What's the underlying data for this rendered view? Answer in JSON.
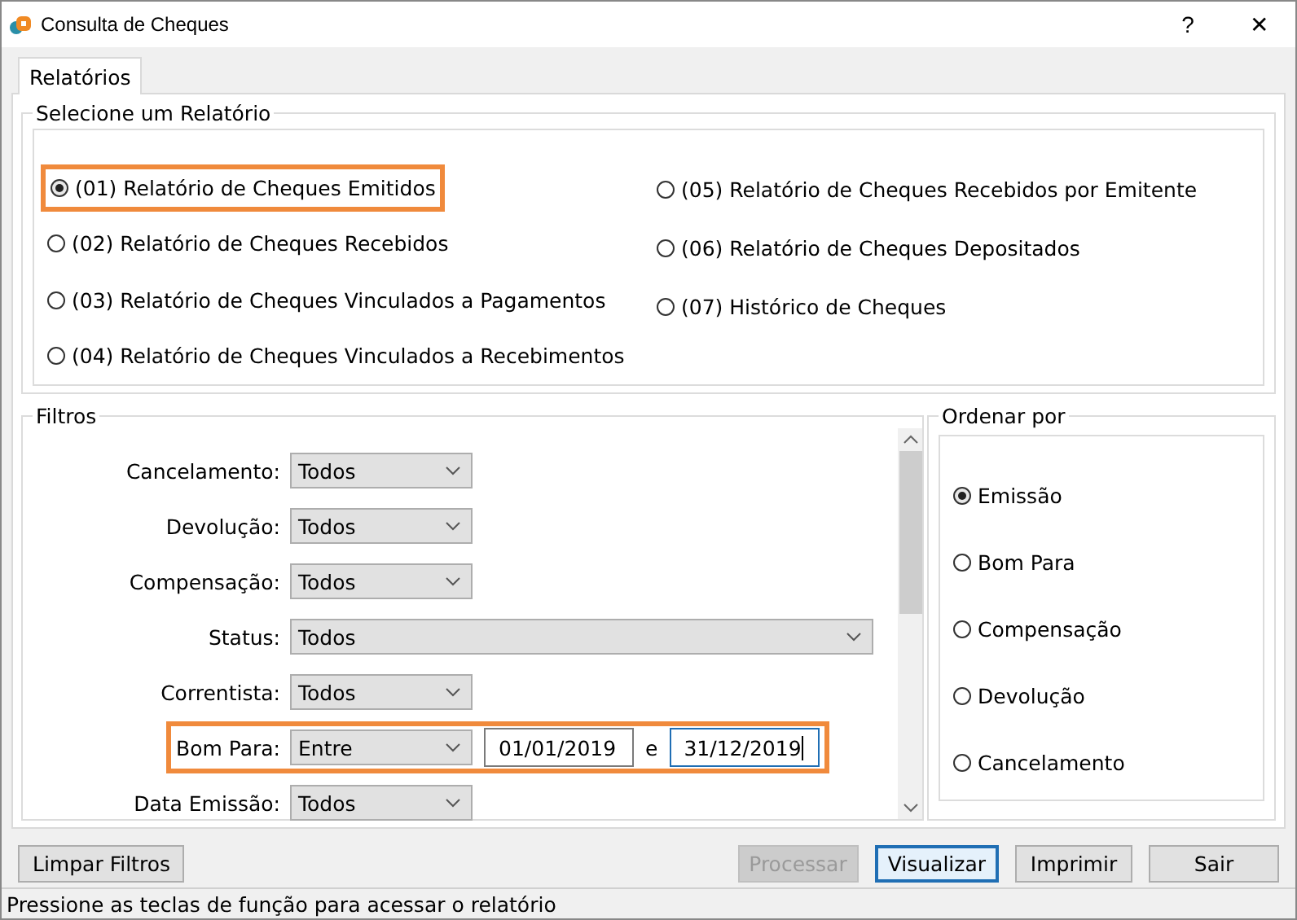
{
  "window": {
    "title": "Consulta de Cheques",
    "help": "?",
    "close": "✕"
  },
  "tabs": [
    {
      "label": "Relatórios",
      "selected": true
    }
  ],
  "reports": {
    "title": "Selecione um Relatório",
    "items": [
      {
        "label": "(01) Relatório de Cheques Emitidos",
        "selected": true,
        "highlighted": true
      },
      {
        "label": "(02) Relatório de Cheques Recebidos",
        "selected": false,
        "highlighted": false
      },
      {
        "label": "(03) Relatório de Cheques Vinculados a Pagamentos",
        "selected": false,
        "highlighted": false
      },
      {
        "label": "(04) Relatório de Cheques Vinculados a Recebimentos",
        "selected": false,
        "highlighted": false
      },
      {
        "label": "(05) Relatório de Cheques Recebidos por Emitente",
        "selected": false,
        "highlighted": false
      },
      {
        "label": "(06) Relatório de Cheques Depositados",
        "selected": false,
        "highlighted": false
      },
      {
        "label": "(07) Histórico de Cheques",
        "selected": false,
        "highlighted": false
      }
    ]
  },
  "filters": {
    "title": "Filtros",
    "items": [
      {
        "kind": "select",
        "label": "Cancelamento:",
        "value": "Todos",
        "wide": false,
        "highlighted": false
      },
      {
        "kind": "select",
        "label": "Devolução:",
        "value": "Todos",
        "wide": false,
        "highlighted": false
      },
      {
        "kind": "select",
        "label": "Compensação:",
        "value": "Todos",
        "wide": false,
        "highlighted": false
      },
      {
        "kind": "select",
        "label": "Status:",
        "value": "Todos",
        "wide": true,
        "highlighted": false
      },
      {
        "kind": "select",
        "label": "Correntista:",
        "value": "Todos",
        "wide": false,
        "highlighted": false
      },
      {
        "kind": "range",
        "label": "Bom Para:",
        "value": "Entre",
        "wide": false,
        "highlighted": true,
        "from": "01/01/2019",
        "separator": "e",
        "to": "31/12/2019"
      },
      {
        "kind": "select",
        "label": "Data Emissão:",
        "value": "Todos",
        "wide": false,
        "highlighted": false
      }
    ]
  },
  "order": {
    "title": "Ordenar por",
    "items": [
      {
        "label": "Emissão",
        "selected": true
      },
      {
        "label": "Bom Para",
        "selected": false
      },
      {
        "label": "Compensação",
        "selected": false
      },
      {
        "label": "Devolução",
        "selected": false
      },
      {
        "label": "Cancelamento",
        "selected": false
      }
    ]
  },
  "buttons": [
    {
      "label": "Limpar Filtros",
      "disabled": false,
      "default": false
    },
    {
      "label": "Processar",
      "disabled": true,
      "default": false
    },
    {
      "label": "Visualizar",
      "disabled": false,
      "default": true
    },
    {
      "label": "Imprimir",
      "disabled": false,
      "default": false
    },
    {
      "label": "Sair",
      "disabled": false,
      "default": false
    }
  ],
  "status_bar": "Pressione as teclas de função para acessar o relatório"
}
